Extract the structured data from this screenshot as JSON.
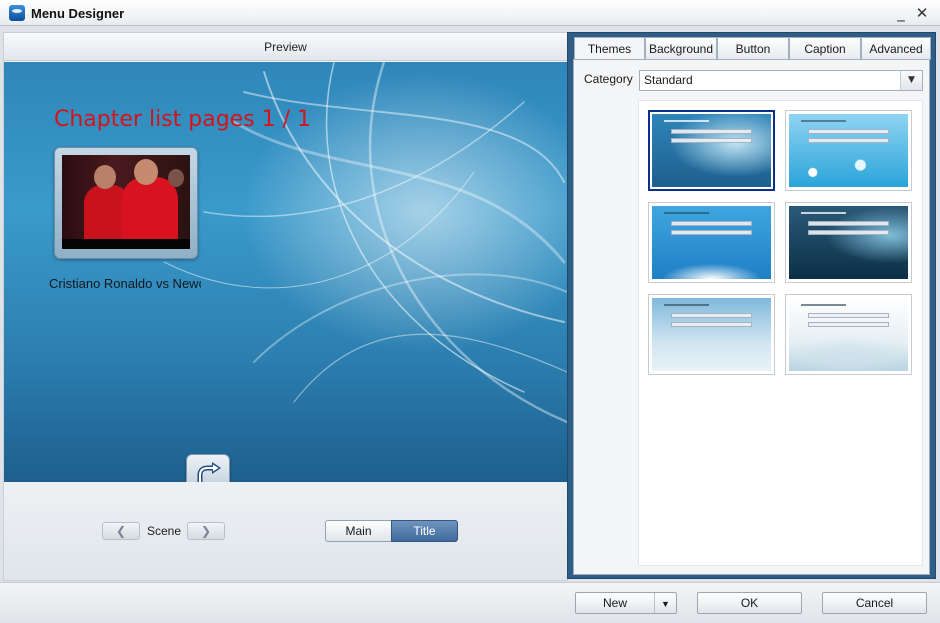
{
  "window": {
    "title": "Menu Designer",
    "minimize_glyph": "_",
    "close_glyph": "✕",
    "app_icon": "app-logo-icon"
  },
  "preview": {
    "header": "Preview",
    "chapter_title": "Chapter list pages 1 / 1",
    "thumbnail_caption": "Cristiano Ronaldo vs Newcastle",
    "return_icon": "return-arrow-icon"
  },
  "scene_nav": {
    "prev_glyph": "❮",
    "next_glyph": "❯",
    "label": "Scene"
  },
  "view_toggle": {
    "main_label": "Main",
    "title_label": "Title",
    "selected": "Title"
  },
  "tabs": [
    {
      "label": "Themes",
      "active": true
    },
    {
      "label": "Background",
      "active": false
    },
    {
      "label": "Button",
      "active": false
    },
    {
      "label": "Caption",
      "active": false
    },
    {
      "label": "Advanced",
      "active": false
    }
  ],
  "themes_tab": {
    "category_label": "Category",
    "category_value": "Standard",
    "dropdown_glyph": "▼",
    "selected_theme_index": 0,
    "theme_count": 6
  },
  "buttons": {
    "new_label": "New",
    "new_dropdown_glyph": "▼",
    "ok_label": "OK",
    "cancel_label": "Cancel"
  },
  "colors": {
    "chapter_title": "#d4141a",
    "panel_frame": "#2e5e86",
    "selected_theme_border": "#0b2f8a",
    "toggle_active": "#3e6a9c"
  }
}
